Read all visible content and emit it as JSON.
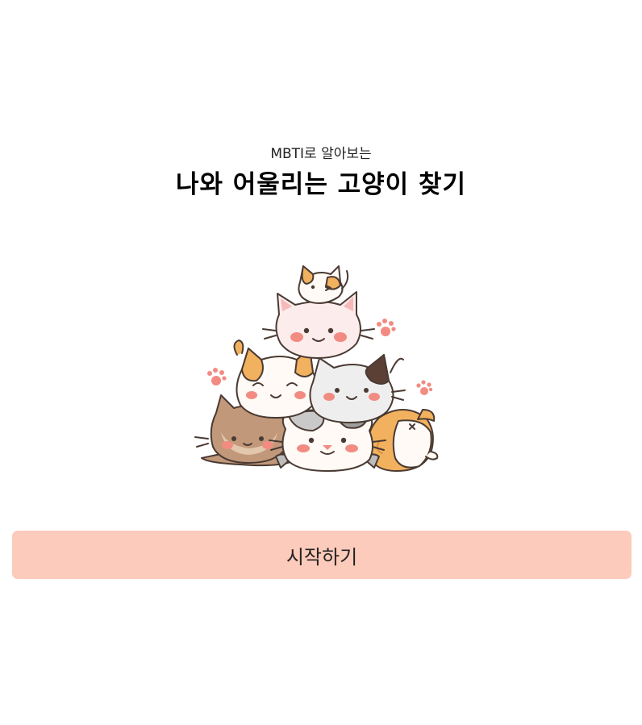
{
  "header": {
    "subtitle": "MBTI로 알아보는",
    "title": "나와 어울리는 고양이 찾기"
  },
  "illustration": {
    "icon": "cat-pile-illustration"
  },
  "actions": {
    "start_label": "시작하기"
  },
  "colors": {
    "background": "#ffffff",
    "button": "#fdcbbb",
    "text": "#000000",
    "cat_orange": "#f2b15e",
    "cat_brown": "#c2987a",
    "cat_white": "#fffaf5",
    "cat_gray": "#d4d4d4",
    "cheek": "#f28b82",
    "outline": "#4a3a33"
  }
}
